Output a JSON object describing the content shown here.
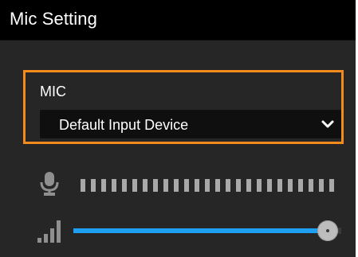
{
  "panel": {
    "title": "Mic Setting"
  },
  "mic": {
    "label": "MIC",
    "selected_device": "Default Input Device",
    "dropdown_icon": "chevron-down-icon",
    "accent_color": "#f28b1c"
  },
  "input_level": {
    "icon": "microphone-icon",
    "segment_count": 25,
    "active_segments": 0,
    "segment_color": "#a9a9a9"
  },
  "volume": {
    "icon": "signal-bars-icon",
    "value_percent": 100,
    "fill_color": "#1e9ff2"
  }
}
